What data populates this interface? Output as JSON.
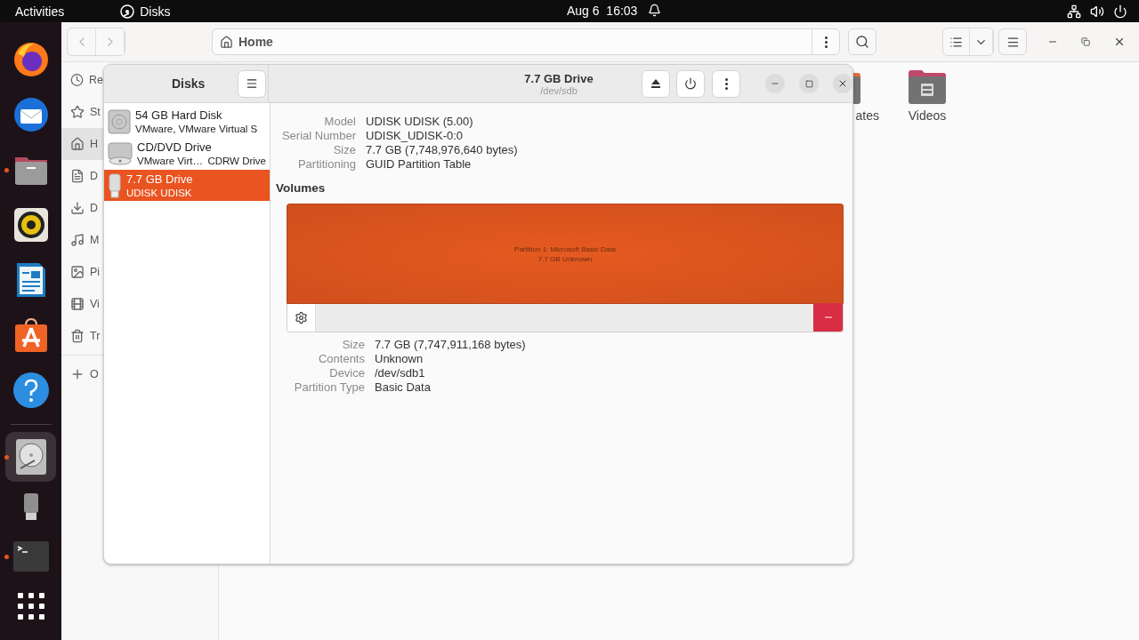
{
  "top_bar": {
    "activities": "Activities",
    "app_name": "Disks",
    "clock": "Aug 6  16:03"
  },
  "dock": {
    "pinned": [
      {
        "kind": "browser",
        "running": false,
        "selected": false
      },
      {
        "kind": "mail",
        "running": false,
        "selected": false
      },
      {
        "kind": "files",
        "running": true,
        "selected": false
      },
      {
        "kind": "music",
        "running": false,
        "selected": false
      },
      {
        "kind": "writer",
        "running": false,
        "selected": false
      },
      {
        "kind": "store",
        "running": false,
        "selected": false
      },
      {
        "kind": "help",
        "running": false,
        "selected": false
      }
    ],
    "other": [
      {
        "kind": "disks",
        "running": true,
        "selected": true
      },
      {
        "kind": "usb",
        "running": false,
        "selected": false
      },
      {
        "kind": "terminal",
        "running": true,
        "selected": false
      },
      {
        "kind": "apps",
        "running": false,
        "selected": false
      }
    ]
  },
  "files_window": {
    "location": "Home",
    "sidebar": [
      {
        "kind": "recent",
        "label": "Re",
        "selected": false
      },
      {
        "kind": "starred",
        "label": "St",
        "selected": false
      },
      {
        "kind": "home",
        "label": "H",
        "selected": true
      },
      {
        "kind": "documents",
        "label": "D",
        "selected": false
      },
      {
        "kind": "downloads",
        "label": "D",
        "selected": false
      },
      {
        "kind": "music",
        "label": "M",
        "selected": false
      },
      {
        "kind": "pictures",
        "label": "Pi",
        "selected": false
      },
      {
        "kind": "videos",
        "label": "Vi",
        "selected": false
      },
      {
        "kind": "trash",
        "label": "Tr",
        "selected": false
      },
      {
        "kind": "other",
        "label": "O",
        "selected": false
      }
    ],
    "items": [
      {
        "label": "ates"
      },
      {
        "label": "Videos"
      }
    ]
  },
  "disks_window": {
    "sidebar_title": "Disks",
    "title": "7.7 GB Drive",
    "subtitle": "/dev/sdb",
    "drives": [
      {
        "kind": "hdd",
        "name": "54 GB Hard Disk",
        "detail": "VMware, VMware Virtual S",
        "selected": false
      },
      {
        "kind": "optical",
        "name": "CD/DVD Drive",
        "detail": "VMware Virt…",
        "extra": "CDRW Drive",
        "selected": false
      },
      {
        "kind": "usb",
        "name": "7.7 GB Drive",
        "detail": "UDISK UDISK",
        "selected": true
      }
    ],
    "drive_info": [
      {
        "label": "Model",
        "value": "UDISK UDISK (5.00)"
      },
      {
        "label": "Serial Number",
        "value": "UDISK_UDISK-0:0"
      },
      {
        "label": "Size",
        "value": "7.7 GB (7,748,976,640 bytes)"
      },
      {
        "label": "Partitioning",
        "value": "GUID Partition Table"
      }
    ],
    "volumes_heading": "Volumes",
    "volumes": [
      {
        "name": "Partition 1: Microsoft Basic Data",
        "detail": "7.7 GB Unknown",
        "selected": true
      }
    ],
    "partition_info": [
      {
        "label": "Size",
        "value": "7.7 GB (7,747,911,168 bytes)"
      },
      {
        "label": "Contents",
        "value": "Unknown"
      },
      {
        "label": "Device",
        "value": "/dev/sdb1"
      },
      {
        "label": "Partition Type",
        "value": "Basic Data"
      }
    ]
  }
}
